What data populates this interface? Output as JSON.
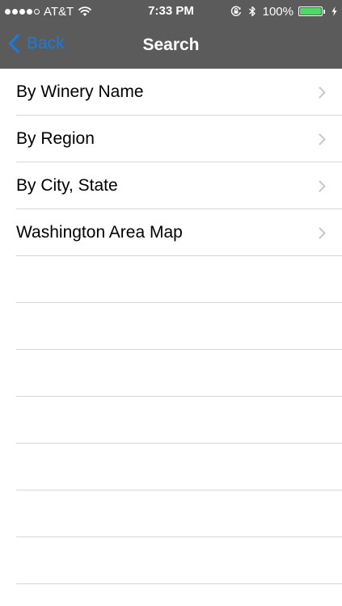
{
  "status_bar": {
    "carrier": "AT&T",
    "time": "7:33 PM",
    "battery_percent": "100%",
    "battery_level": 1.0,
    "battery_color": "#4cd964",
    "icons": [
      "signal-dots",
      "wifi-icon",
      "orientation-lock-icon",
      "bluetooth-icon",
      "battery-icon",
      "charging-icon"
    ]
  },
  "nav": {
    "back_label": "Back",
    "title": "Search",
    "accent_color": "#1a7bdf"
  },
  "menu": {
    "items": [
      {
        "label": "By Winery Name"
      },
      {
        "label": "By Region"
      },
      {
        "label": "By City, State"
      },
      {
        "label": "Washington Area Map"
      }
    ]
  }
}
